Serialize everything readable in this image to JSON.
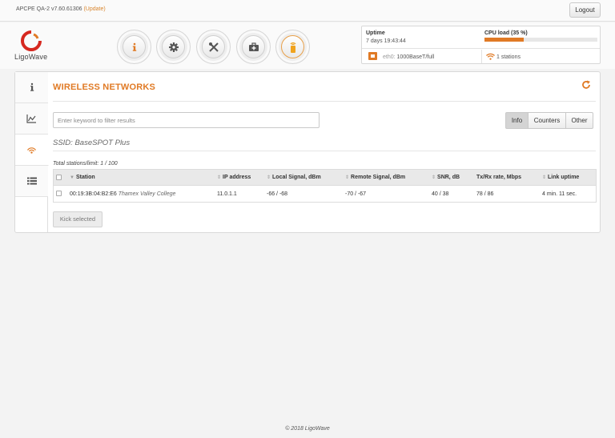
{
  "topbar": {
    "firmware": "APCPE QA-2 v7.60.61306",
    "update_label": "(Update)",
    "logout_label": "Logout"
  },
  "brand": {
    "name": "LigoWave"
  },
  "nav": [
    {
      "icon": "info-icon"
    },
    {
      "icon": "gear-icon"
    },
    {
      "icon": "tools-icon"
    },
    {
      "icon": "toolbox-icon"
    },
    {
      "icon": "device-signal-icon"
    }
  ],
  "status": {
    "uptime_label": "Uptime",
    "uptime_value": "7 days 19:43:44",
    "cpu_label": "CPU load (35 %)",
    "cpu_percent": 35,
    "eth_name": "eth0:",
    "eth_value": "1000BaseT/full",
    "stations": "1 stations"
  },
  "sidebar": [
    {
      "icon": "info-icon"
    },
    {
      "icon": "chart-icon"
    },
    {
      "icon": "wireless-icon"
    },
    {
      "icon": "list-icon"
    }
  ],
  "main": {
    "title": "WIRELESS NETWORKS",
    "filter_placeholder": "Enter keyword to filter results",
    "view_buttons": [
      "Info",
      "Counters",
      "Other"
    ],
    "ssid": "SSID: BaseSPOT Plus",
    "total": "Total stations/limit: 1 / 100",
    "table": {
      "headers": [
        "Station",
        "IP address",
        "Local Signal, dBm",
        "Remote Signal, dBm",
        "SNR, dB",
        "Tx/Rx rate, Mbps",
        "Link uptime"
      ],
      "rows": [
        {
          "mac": "00:19:3B:04:B2:E6",
          "name": "Thamex Valley College",
          "ip": "11.0.1.1",
          "local_signal": "-66 / -68",
          "remote_signal": "-70 / -67",
          "snr": "40 / 38",
          "rate": "78 / 86",
          "uptime": "4 min. 11 sec."
        }
      ]
    },
    "kick_label": "Kick selected"
  },
  "footer": {
    "text": "© 2018 LigoWave"
  },
  "colors": {
    "accent": "#e07a25"
  }
}
